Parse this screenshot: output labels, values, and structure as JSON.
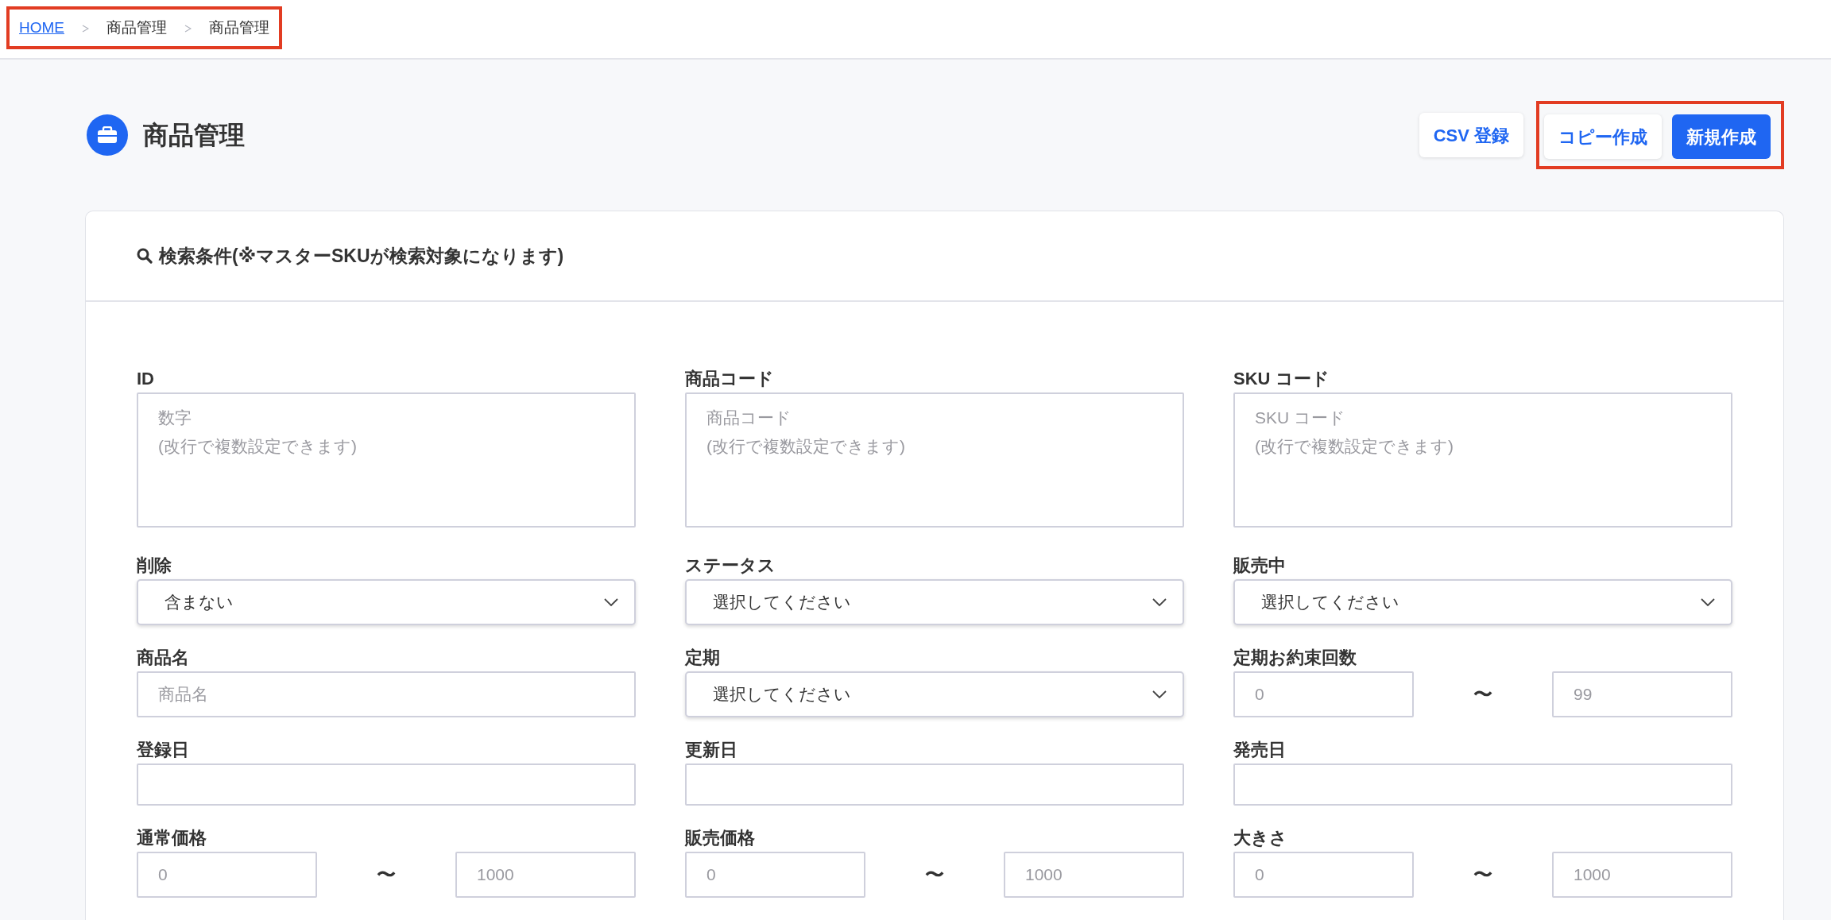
{
  "breadcrumb": {
    "highlighted": true,
    "items": [
      {
        "label": "HOME",
        "link": true
      },
      {
        "label": "商品管理",
        "link": false
      },
      {
        "label": "商品管理",
        "link": false
      }
    ]
  },
  "page_title": "商品管理",
  "buttons": [
    {
      "label": "CSV 登録",
      "kind": "light",
      "highlighted": false
    },
    {
      "label": "コピー作成",
      "kind": "light",
      "highlighted": true
    },
    {
      "label": "新規作成",
      "kind": "primary",
      "highlighted": true
    }
  ],
  "search_panel": {
    "title": "検索条件(※マスターSKUが検索対象になります)",
    "fields": [
      {
        "label": "ID",
        "kind": "textarea",
        "placeholder": "数字\n(改行で複数設定できます)"
      },
      {
        "label": "商品コード",
        "kind": "textarea",
        "placeholder": "商品コード\n(改行で複数設定できます)"
      },
      {
        "label": "SKU コード",
        "kind": "textarea",
        "placeholder": "SKU コード\n(改行で複数設定できます)"
      },
      {
        "label": "削除",
        "kind": "select",
        "value": "含まない"
      },
      {
        "label": "ステータス",
        "kind": "select",
        "value": "選択してください"
      },
      {
        "label": "販売中",
        "kind": "select",
        "value": "選択してください"
      },
      {
        "label": "商品名",
        "kind": "text",
        "placeholder": "商品名"
      },
      {
        "label": "定期",
        "kind": "select",
        "value": "選択してください"
      },
      {
        "label": "定期お約束回数",
        "kind": "range",
        "from": {
          "placeholder": "0"
        },
        "separator": "〜",
        "to": {
          "placeholder": "99"
        }
      },
      {
        "label": "登録日",
        "kind": "date"
      },
      {
        "label": "更新日",
        "kind": "date"
      },
      {
        "label": "発売日",
        "kind": "date"
      },
      {
        "label": "通常価格",
        "kind": "range",
        "from": {
          "placeholder": "0"
        },
        "separator": "〜",
        "to": {
          "placeholder": "1000"
        }
      },
      {
        "label": "販売価格",
        "kind": "range",
        "from": {
          "placeholder": "0"
        },
        "separator": "〜",
        "to": {
          "placeholder": "1000"
        }
      },
      {
        "label": "大きさ",
        "kind": "range",
        "from": {
          "placeholder": "0"
        },
        "separator": "〜",
        "to": {
          "placeholder": "1000"
        }
      }
    ]
  }
}
